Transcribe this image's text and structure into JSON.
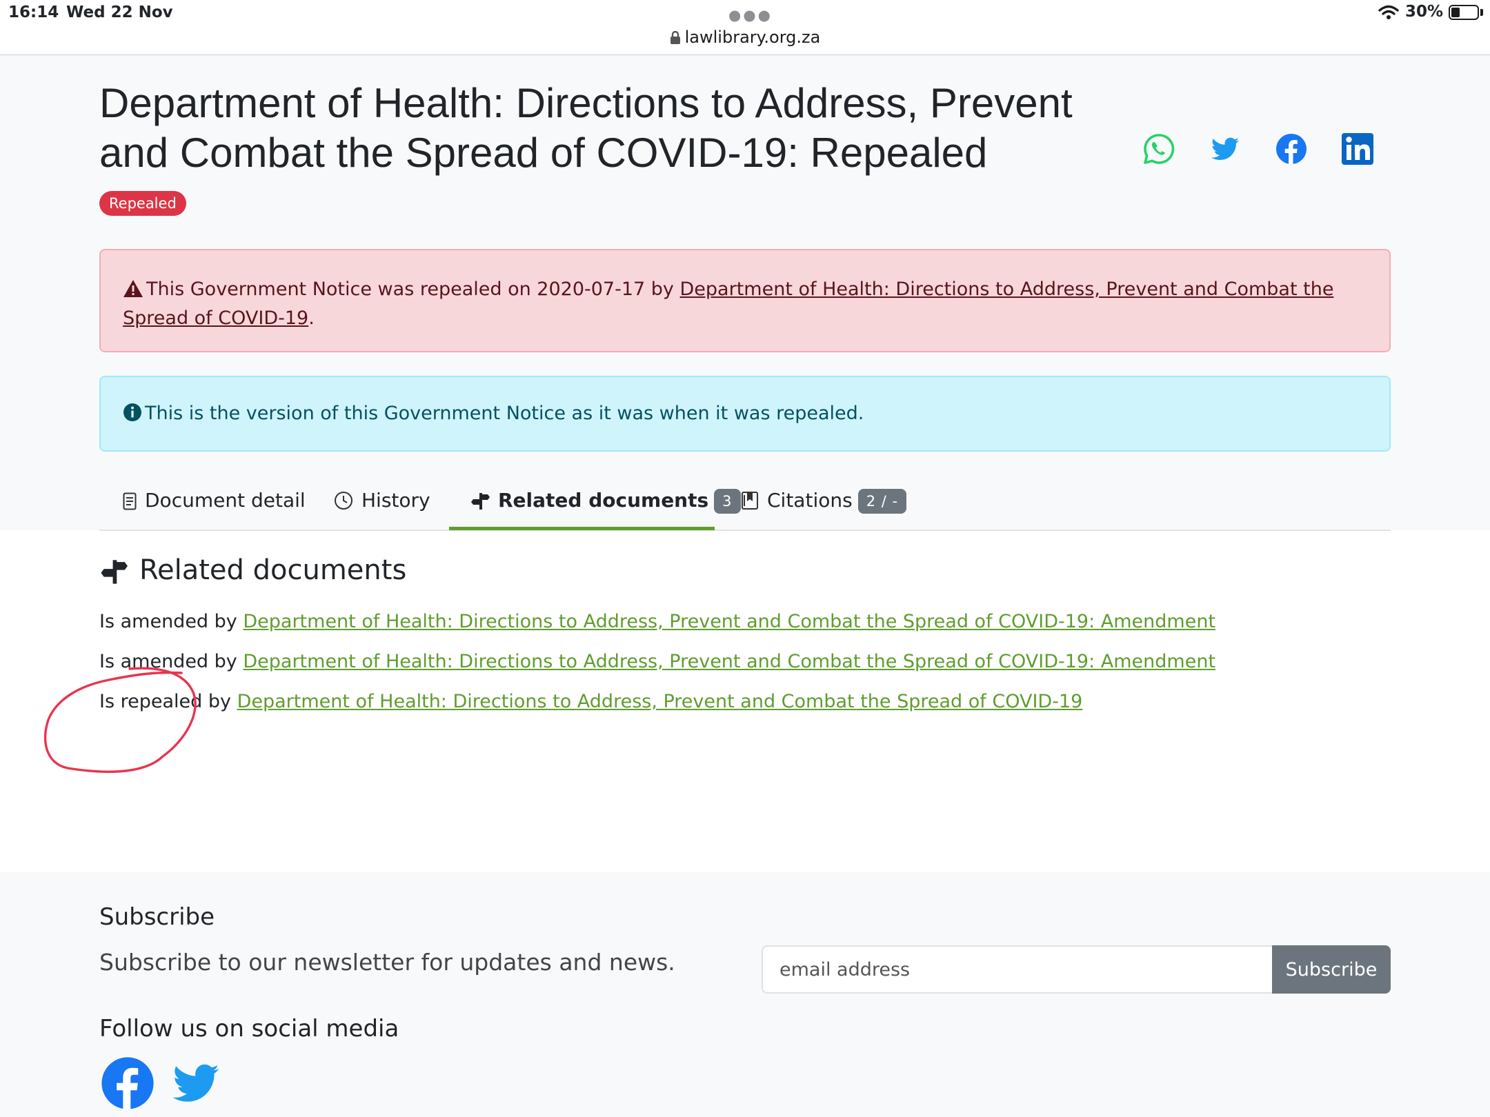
{
  "status_bar": {
    "time": "16:14",
    "date": "Wed 22 Nov",
    "url": "lawlibrary.org.za",
    "battery": "30%"
  },
  "document": {
    "title": "Department of Health: Directions to Address, Prevent and Combat the Spread of COVID-19: Repealed",
    "badge": "Repealed"
  },
  "share_icons": [
    "whatsapp-icon",
    "twitter-icon",
    "facebook-icon",
    "linkedin-icon"
  ],
  "alerts": {
    "repealed_prefix": "This Government Notice was repealed on 2020-07-17 by",
    "repealed_link": "Department of Health: Directions to Address, Prevent and Combat the Spread of COVID-19",
    "repealed_suffix": ".",
    "info": "This is the version of this Government Notice as it was when it was repealed."
  },
  "tabs": [
    {
      "label": "Document detail",
      "icon": "document-icon"
    },
    {
      "label": "History",
      "icon": "clock-icon"
    },
    {
      "label": "Related documents",
      "icon": "signpost-icon",
      "count": "3",
      "active": true
    },
    {
      "label": "Citations",
      "icon": "bookmark-icon",
      "count": "2 / -"
    }
  ],
  "related": {
    "heading": "Related documents",
    "rows": [
      {
        "relation": "Is amended by",
        "link": "Department of Health: Directions to Address, Prevent and Combat the Spread of COVID-19: Amendment"
      },
      {
        "relation": "Is amended by",
        "link": "Department of Health: Directions to Address, Prevent and Combat the Spread of COVID-19: Amendment"
      },
      {
        "relation": "Is repealed by",
        "link": "Department of Health: Directions to Address, Prevent and Combat the Spread of COVID-19"
      }
    ]
  },
  "footer": {
    "subscribe_title": "Subscribe",
    "subscribe_text": "Subscribe to our newsletter for updates and news.",
    "email_placeholder": "email address",
    "subscribe_button": "Subscribe",
    "follow_title": "Follow us on social media"
  },
  "colors": {
    "link_green": "#5f9d2e",
    "danger": "#dc3545",
    "annotation_red": "#e8344e"
  }
}
